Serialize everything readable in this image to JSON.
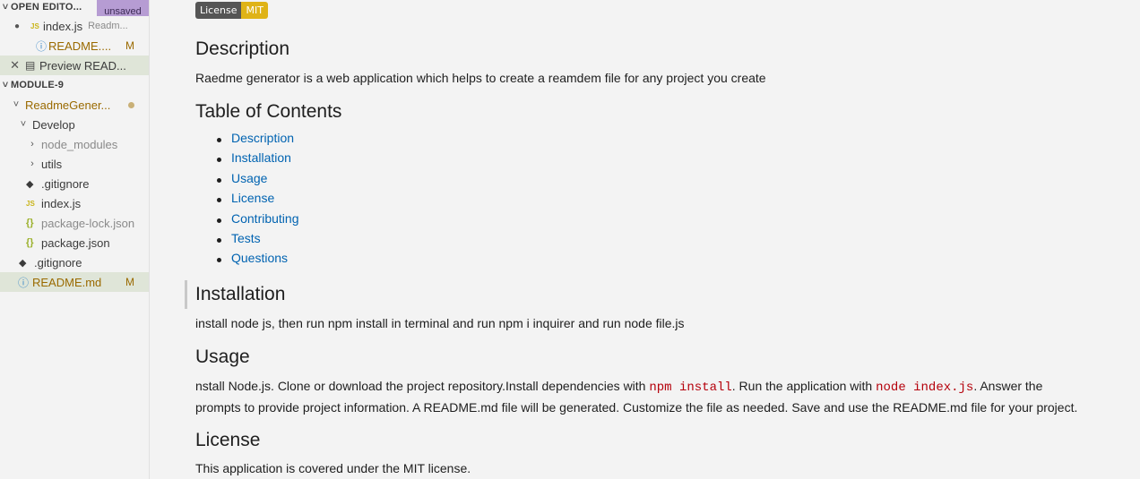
{
  "explorer": {
    "open_editors_header": "OPEN EDITO...",
    "unsaved_badge": "unsaved",
    "open_editors": [
      {
        "name": "index.js",
        "desc": "Readm..."
      },
      {
        "name": "README....",
        "status": "M"
      },
      {
        "name": "Preview READ..."
      }
    ],
    "workspace_header": "MODULE-9",
    "tree": [
      {
        "name": "ReadmeGener..."
      },
      {
        "name": "Develop"
      },
      {
        "name": "node_modules"
      },
      {
        "name": "utils"
      },
      {
        "name": ".gitignore"
      },
      {
        "name": "index.js"
      },
      {
        "name": "package-lock.json"
      },
      {
        "name": "package.json"
      },
      {
        "name": ".gitignore"
      },
      {
        "name": "README.md",
        "status": "M"
      }
    ]
  },
  "preview": {
    "license_badge": {
      "label": "License",
      "value": "MIT"
    },
    "description": {
      "heading": "Description",
      "text": "Raedme generator is a web application which helps to create a reamdem file for any project you create"
    },
    "toc": {
      "heading": "Table of Contents",
      "items": [
        "Description",
        "Installation",
        "Usage",
        "License",
        "Contributing",
        "Tests",
        "Questions"
      ]
    },
    "installation": {
      "heading": "Installation",
      "text": "install node js, then run npm install in terminal and run npm i inquirer and run node file.js"
    },
    "usage": {
      "heading": "Usage",
      "text_1": "nstall Node.js. Clone or download the project repository.Install dependencies with ",
      "code_1": "npm install",
      "text_2": ". Run the application with ",
      "code_2": "node index.js",
      "text_3": ". Answer the",
      "text_4": "prompts to provide project information. A README.md file will be generated. Customize the file as needed. Save and use the README.md file for your project."
    },
    "license": {
      "heading": "License",
      "text": "This application is covered under the MIT license."
    }
  }
}
